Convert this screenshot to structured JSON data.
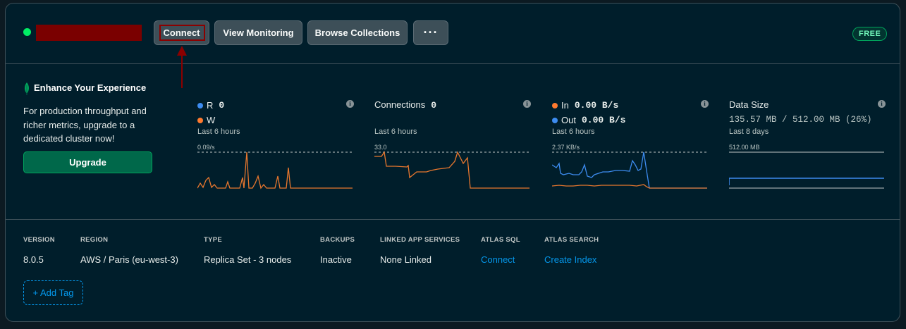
{
  "cluster": {
    "status_color": "#00ed64",
    "tier_badge": "FREE"
  },
  "toolbar": {
    "connect_label": "Connect",
    "view_monitoring_label": "View Monitoring",
    "browse_collections_label": "Browse Collections",
    "more_label": "···"
  },
  "promo": {
    "title": "Enhance Your Experience",
    "text": "For production throughput and richer metrics, upgrade to a dedicated cluster now!",
    "button": "Upgrade"
  },
  "colors": {
    "read": "#3d8cf0",
    "write": "#ff7a2f",
    "in": "#ff7a2f",
    "out": "#3d8cf0",
    "chart_line_orange": "#e8772e",
    "chart_line_blue": "#3d8cf0"
  },
  "metrics": {
    "opcounters": {
      "r_label": "R",
      "r_value": "0",
      "w_label": "W",
      "period": "Last 6 hours",
      "max": "0.09/s"
    },
    "connections": {
      "title": "Connections",
      "value": "0",
      "period": "Last 6 hours",
      "max": "33.0"
    },
    "network": {
      "in_label": "In",
      "in_value": "0.00 B/s",
      "out_label": "Out",
      "out_value": "0.00 B/s",
      "period": "Last 6 hours",
      "max": "2.37 KB/s"
    },
    "data_size": {
      "title": "Data Size",
      "value": "135.57 MB / 512.00 MB (26%)",
      "period": "Last 8 days",
      "max": "512.00 MB"
    }
  },
  "details": [
    {
      "label": "VERSION",
      "value": "8.0.5",
      "link": false
    },
    {
      "label": "REGION",
      "value": "AWS / Paris (eu-west-3)",
      "link": false
    },
    {
      "label": "TYPE",
      "value": "Replica Set - 3 nodes",
      "link": false
    },
    {
      "label": "BACKUPS",
      "value": "Inactive",
      "link": false
    },
    {
      "label": "LINKED APP SERVICES",
      "value": "None Linked",
      "link": false
    },
    {
      "label": "ATLAS SQL",
      "value": "Connect",
      "link": true
    },
    {
      "label": "ATLAS SEARCH",
      "value": "Create Index",
      "link": true
    }
  ],
  "add_tag_label": "+ Add Tag"
}
